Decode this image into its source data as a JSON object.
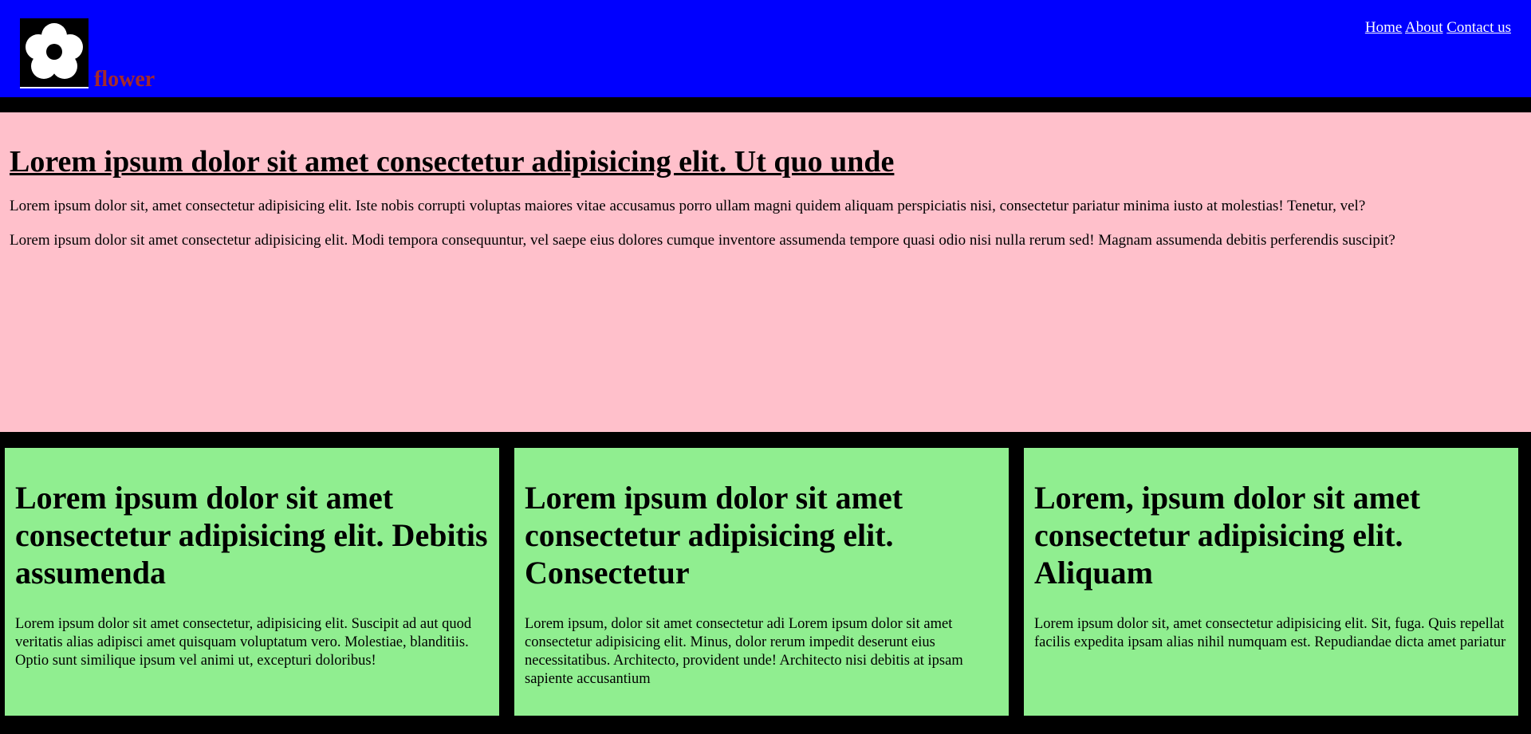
{
  "header": {
    "brand": "flower",
    "logo_icon": "flower-icon",
    "nav": [
      {
        "label": "Home"
      },
      {
        "label": "About"
      },
      {
        "label": "Contact us"
      }
    ]
  },
  "hero": {
    "title": "Lorem ipsum dolor sit amet consectetur adipisicing elit. Ut quo unde",
    "paragraphs": [
      "Lorem ipsum dolor sit, amet consectetur adipisicing elit. Iste nobis corrupti voluptas maiores vitae accusamus porro ullam magni quidem aliquam perspiciatis nisi, consectetur pariatur minima iusto at molestias! Tenetur, vel?",
      "Lorem ipsum dolor sit amet consectetur adipisicing elit. Modi tempora consequuntur, vel saepe eius dolores cumque inventore assumenda tempore quasi odio nisi nulla rerum sed! Magnam assumenda debitis perferendis suscipit?"
    ]
  },
  "cards": [
    {
      "title": "Lorem ipsum dolor sit amet consectetur adipisicing elit. Debitis assumenda",
      "text": "Lorem ipsum dolor sit amet consectetur, adipisicing elit. Suscipit ad aut quod veritatis alias adipisci amet quisquam voluptatum vero. Molestiae, blanditiis. Optio sunt similique ipsum vel animi ut, excepturi doloribus!"
    },
    {
      "title": "Lorem ipsum dolor sit amet consectetur adipisicing elit. Consectetur",
      "text": "Lorem ipsum, dolor sit amet consectetur adi Lorem ipsum dolor sit amet consectetur adipisicing elit. Minus, dolor rerum impedit deserunt eius necessitatibus. Architecto, provident unde! Architecto nisi debitis at ipsam sapiente accusantium"
    },
    {
      "title": "Lorem, ipsum dolor sit amet consectetur adipisicing elit. Aliquam",
      "text": "Lorem ipsum dolor sit, amet consectetur adipisicing elit. Sit, fuga. Quis repellat facilis expedita ipsam alias nihil numquam est. Repudiandae dicta amet pariatur"
    }
  ],
  "colors": {
    "header_bg": "#0000ff",
    "page_bg": "#000000",
    "hero_bg": "#ffc0cb",
    "card_bg": "#90ee90",
    "brand_text": "#a52a2a",
    "nav_text": "#ffffff"
  }
}
